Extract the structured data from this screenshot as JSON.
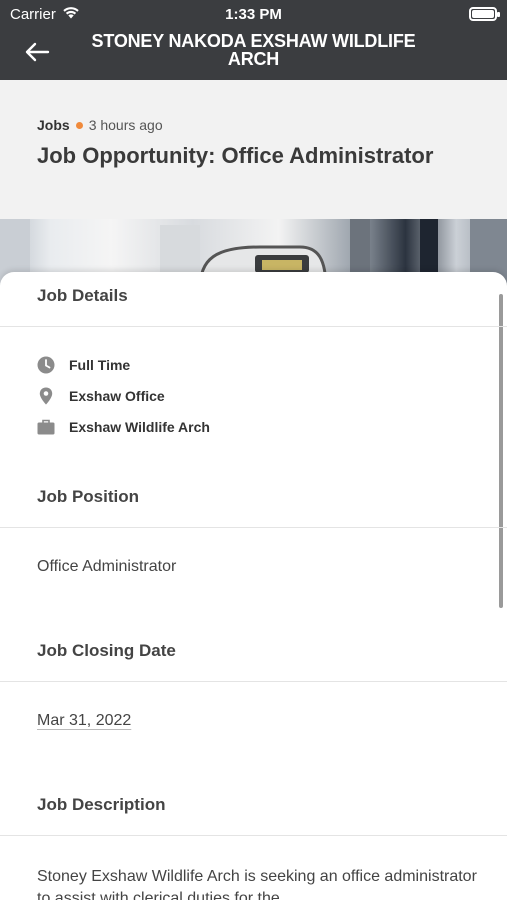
{
  "status_bar": {
    "carrier": "Carrier",
    "time": "1:33 PM"
  },
  "header": {
    "title": "STONEY NAKODA EXSHAW WILDLIFE ARCH",
    "back_icon": "arrow-left-icon"
  },
  "article": {
    "category": "Jobs",
    "time_ago": "3 hours ago",
    "headline": "Job Opportunity: Office Administrator",
    "accent_color": "#f08a3c"
  },
  "job_details": {
    "title": "Job Details",
    "items": [
      {
        "icon": "clock-icon",
        "label": "Full Time"
      },
      {
        "icon": "location-pin-icon",
        "label": "Exshaw Office"
      },
      {
        "icon": "briefcase-icon",
        "label": "Exshaw Wildlife Arch"
      }
    ]
  },
  "job_position": {
    "title": "Job Position",
    "value": "Office Administrator"
  },
  "closing_date": {
    "title": "Job Closing Date",
    "value": "Mar 31, 2022"
  },
  "description": {
    "title": "Job Description",
    "text": "Stoney Exshaw Wildlife Arch is seeking an office administrator to assist with clerical duties for the"
  }
}
